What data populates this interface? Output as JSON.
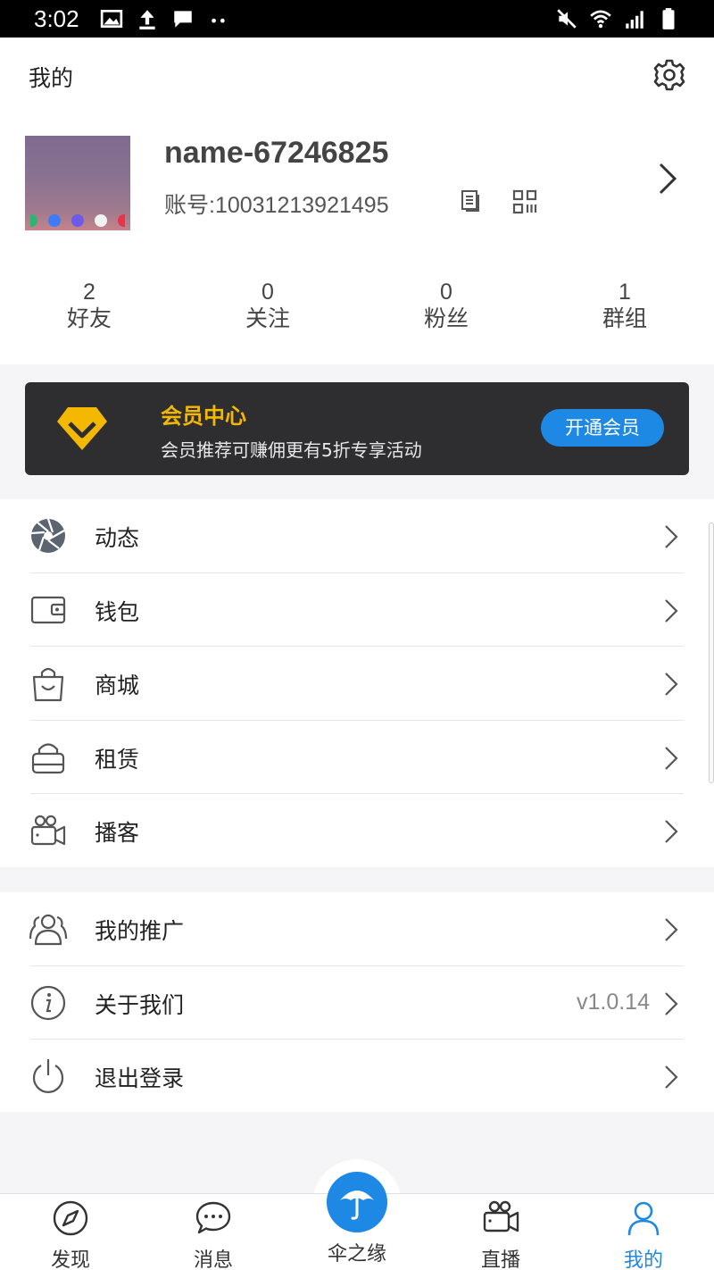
{
  "status_bar": {
    "time": "3:02"
  },
  "header": {
    "title": "我的",
    "settings_icon": "gear-icon"
  },
  "profile": {
    "name": "name-67246825",
    "account": "账号:10031213921495"
  },
  "stats": [
    {
      "value": "2",
      "label": "好友"
    },
    {
      "value": "0",
      "label": "关注"
    },
    {
      "value": "0",
      "label": "粉丝"
    },
    {
      "value": "1",
      "label": "群组"
    }
  ],
  "vip": {
    "title": "会员中心",
    "subtitle": "会员推荐可赚佣更有5折专享活动",
    "button": "开通会员"
  },
  "menu_group1": [
    {
      "label": "动态",
      "icon": "aperture-icon"
    },
    {
      "label": "钱包",
      "icon": "wallet-icon"
    },
    {
      "label": "商城",
      "icon": "shopping-bag-icon"
    },
    {
      "label": "租赁",
      "icon": "lock-bag-icon"
    },
    {
      "label": "播客",
      "icon": "video-camera-icon"
    }
  ],
  "menu_group2": [
    {
      "label": "我的推广",
      "icon": "users-icon"
    },
    {
      "label": "关于我们",
      "icon": "info-icon",
      "value": "v1.0.14"
    },
    {
      "label": "退出登录",
      "icon": "power-icon"
    }
  ],
  "tabs": [
    {
      "label": "发现",
      "icon": "compass-icon"
    },
    {
      "label": "消息",
      "icon": "chat-icon"
    },
    {
      "label": "伞之缘",
      "icon": "umbrella-icon"
    },
    {
      "label": "直播",
      "icon": "camera-icon"
    },
    {
      "label": "我的",
      "icon": "person-icon"
    }
  ],
  "colors": {
    "accent": "#1e88e5",
    "vip_gold": "#f5b800",
    "vip_bg": "#2e2e30"
  }
}
